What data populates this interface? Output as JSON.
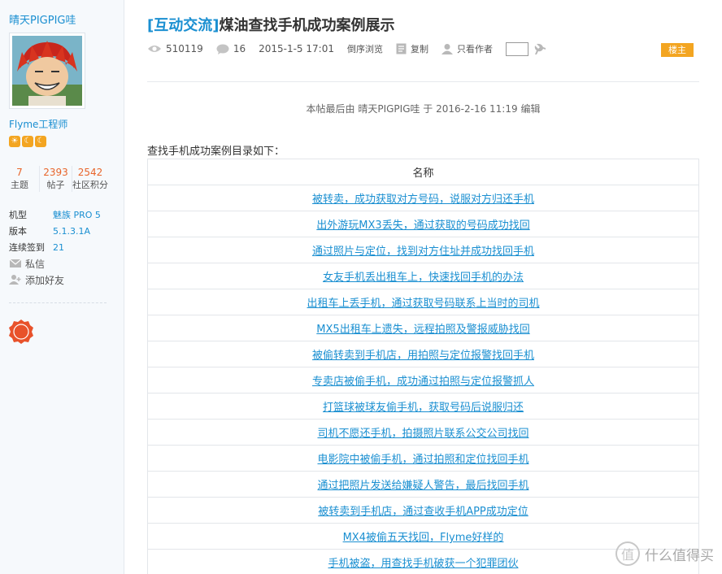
{
  "author": {
    "name": "晴天PIGPIG哇",
    "role": "Flyme工程师",
    "badges": [
      "☀",
      "☾",
      "☾"
    ],
    "stats": [
      {
        "value": "7",
        "label": "主题"
      },
      {
        "value": "2393",
        "label": "帖子"
      },
      {
        "value": "2542",
        "label": "社区积分"
      }
    ],
    "info": [
      {
        "key": "机型",
        "value": "魅族 PRO 5"
      },
      {
        "key": "版本",
        "value": "5.1.3.1A"
      },
      {
        "key": "连续签到",
        "value": "21"
      }
    ],
    "actions": {
      "message": "私信",
      "add_friend": "添加好友"
    }
  },
  "post": {
    "category": "[互动交流]",
    "title": "煤油查找手机成功案例展示",
    "views": "510119",
    "replies": "16",
    "date": "2015-1-5 17:01",
    "reverse_view": "倒序浏览",
    "copy": "复制",
    "only_author": "只看作者",
    "floor_badge": "楼主",
    "edit_note": "本帖最后由 晴天PIGPIG哇 于 2016-2-16 11:19 编辑",
    "intro": "查找手机成功案例目录如下：",
    "table_header": "名称",
    "rows": [
      "被转卖，成功获取对方号码，说服对方归还手机",
      "出外游玩MX3丢失，通过获取的号码成功找回",
      "通过照片与定位，找到对方住址并成功找回手机",
      "女友手机丢出租车上，快速找回手机的办法",
      "出租车上丢手机，通过获取号码联系上当时的司机",
      "MX5出租车上遗失，远程拍照及警报威胁找回",
      "被偷转卖到手机店，用拍照与定位报警找回手机",
      "专卖店被偷手机，成功通过拍照与定位报警抓人",
      "打篮球被球友偷手机，获取号码后说服归还",
      "司机不愿还手机，拍摄照片联系公交公司找回",
      "电影院中被偷手机，通过拍照和定位找回手机",
      "通过把照片发送给嫌疑人警告，最后找回手机",
      "被转卖到手机店，通过查收手机APP成功定位",
      "MX4被偷五天找回，Flyme好样的",
      "手机被盗，用查找手机破获一个犯罪团伙"
    ]
  },
  "watermark": {
    "icon": "值",
    "text": "什么值得买"
  }
}
